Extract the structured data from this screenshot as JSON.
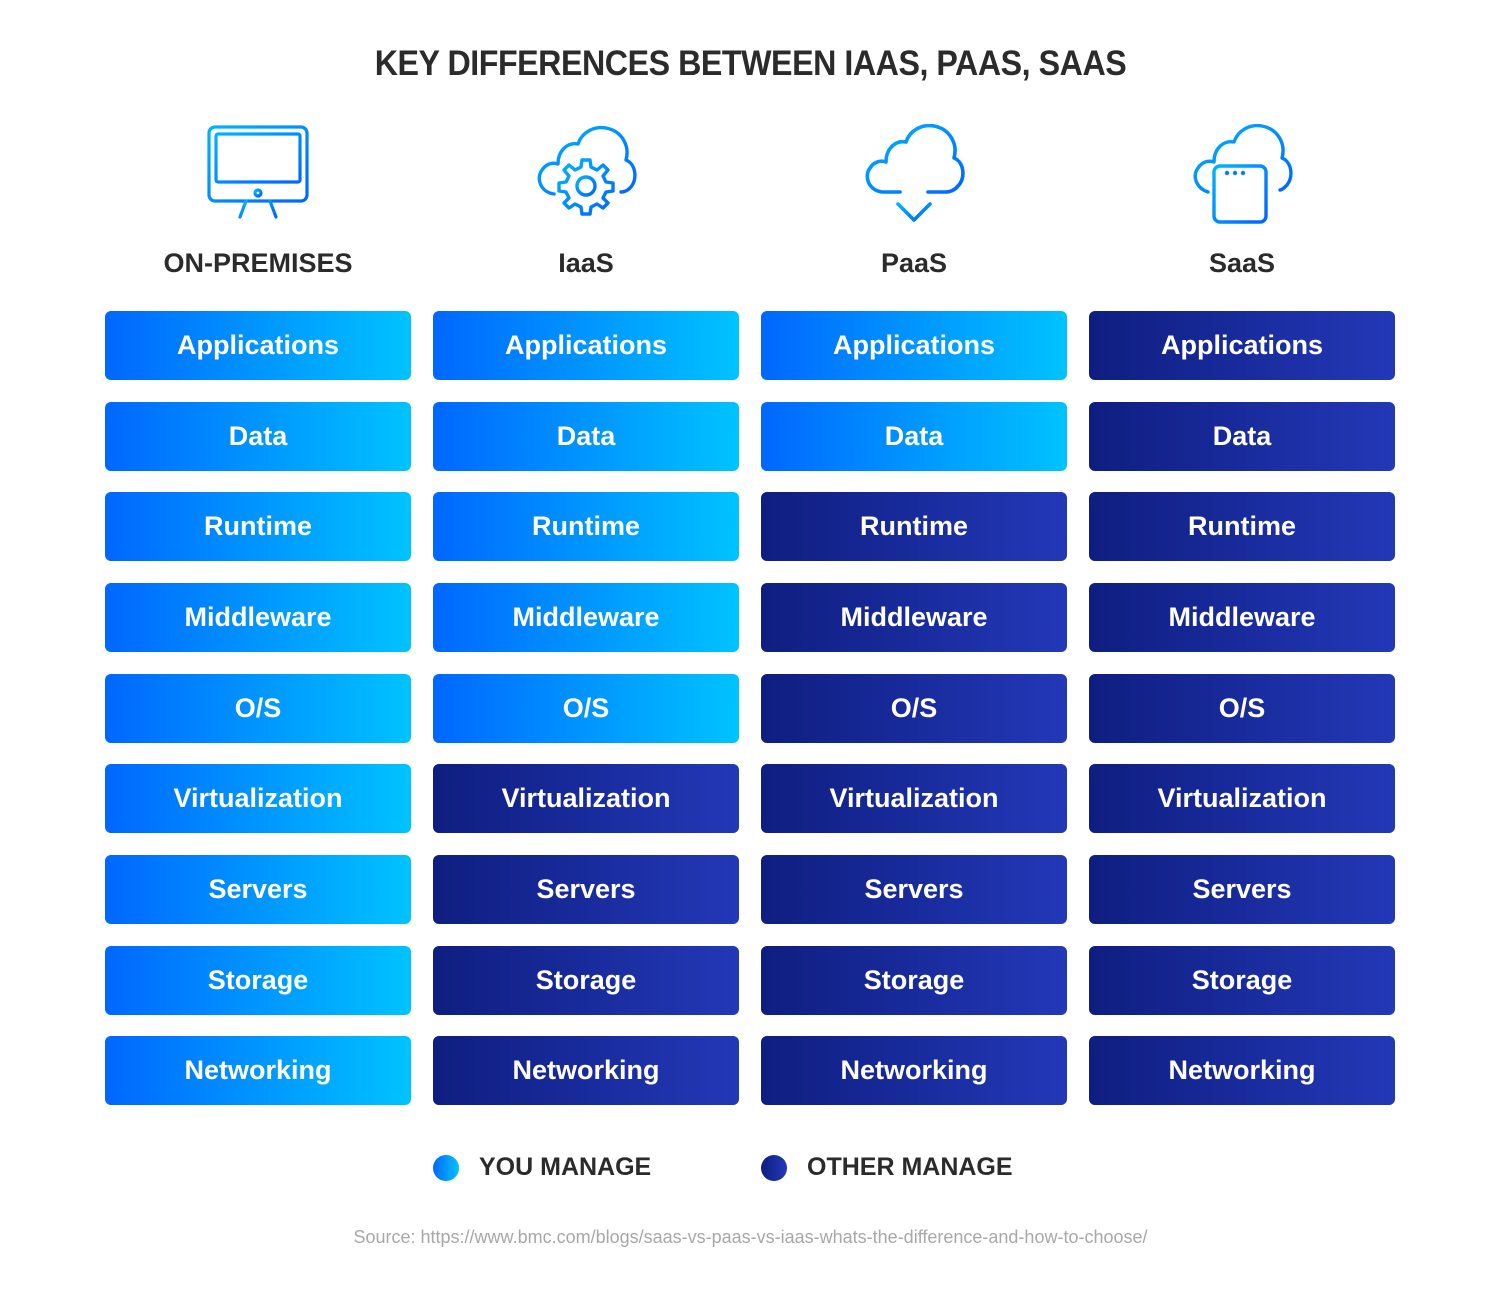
{
  "title": "KEY DIFFERENCES BETWEEN IAAS, PAAS, SAAS",
  "colors": {
    "you_manage_gradient": [
      "#0067ff",
      "#00c3ff"
    ],
    "other_manage_gradient": [
      "#0e1e80",
      "#2338b8"
    ],
    "icon_gradient": [
      "#00b4ff",
      "#0066ff"
    ],
    "text": "#2b2b2b",
    "source_text": "#a8a8a8"
  },
  "columns": [
    {
      "label": "ON-PREMISES",
      "icon": "monitor-icon",
      "layers": [
        {
          "label": "Applications",
          "managed_by": "you"
        },
        {
          "label": "Data",
          "managed_by": "you"
        },
        {
          "label": "Runtime",
          "managed_by": "you"
        },
        {
          "label": "Middleware",
          "managed_by": "you"
        },
        {
          "label": "O/S",
          "managed_by": "you"
        },
        {
          "label": "Virtualization",
          "managed_by": "you"
        },
        {
          "label": "Servers",
          "managed_by": "you"
        },
        {
          "label": "Storage",
          "managed_by": "you"
        },
        {
          "label": "Networking",
          "managed_by": "you"
        }
      ]
    },
    {
      "label": "IaaS",
      "icon": "cloud-gear-icon",
      "layers": [
        {
          "label": "Applications",
          "managed_by": "you"
        },
        {
          "label": "Data",
          "managed_by": "you"
        },
        {
          "label": "Runtime",
          "managed_by": "you"
        },
        {
          "label": "Middleware",
          "managed_by": "you"
        },
        {
          "label": "O/S",
          "managed_by": "you"
        },
        {
          "label": "Virtualization",
          "managed_by": "other"
        },
        {
          "label": "Servers",
          "managed_by": "other"
        },
        {
          "label": "Storage",
          "managed_by": "other"
        },
        {
          "label": "Networking",
          "managed_by": "other"
        }
      ]
    },
    {
      "label": "PaaS",
      "icon": "cloud-download-icon",
      "layers": [
        {
          "label": "Applications",
          "managed_by": "you"
        },
        {
          "label": "Data",
          "managed_by": "you"
        },
        {
          "label": "Runtime",
          "managed_by": "other"
        },
        {
          "label": "Middleware",
          "managed_by": "other"
        },
        {
          "label": "O/S",
          "managed_by": "other"
        },
        {
          "label": "Virtualization",
          "managed_by": "other"
        },
        {
          "label": "Servers",
          "managed_by": "other"
        },
        {
          "label": "Storage",
          "managed_by": "other"
        },
        {
          "label": "Networking",
          "managed_by": "other"
        }
      ]
    },
    {
      "label": "SaaS",
      "icon": "cloud-window-icon",
      "layers": [
        {
          "label": "Applications",
          "managed_by": "other"
        },
        {
          "label": "Data",
          "managed_by": "other"
        },
        {
          "label": "Runtime",
          "managed_by": "other"
        },
        {
          "label": "Middleware",
          "managed_by": "other"
        },
        {
          "label": "O/S",
          "managed_by": "other"
        },
        {
          "label": "Virtualization",
          "managed_by": "other"
        },
        {
          "label": "Servers",
          "managed_by": "other"
        },
        {
          "label": "Storage",
          "managed_by": "other"
        },
        {
          "label": "Networking",
          "managed_by": "other"
        }
      ]
    }
  ],
  "legend": {
    "you_manage": "YOU MANAGE",
    "other_manage": "OTHER MANAGE"
  },
  "source": "Source: https://www.bmc.com/blogs/saas-vs-paas-vs-iaas-whats-the-difference-and-how-to-choose/"
}
